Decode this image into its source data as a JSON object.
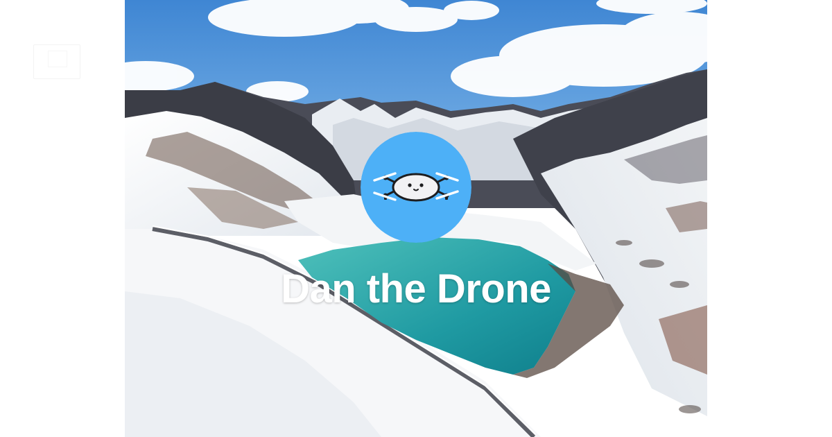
{
  "brand": {
    "name": "Dan the Drone",
    "logo_icon": "drone-mascot-icon",
    "logo_color": "#4db0f7"
  },
  "hero": {
    "scene": "mountain-lake-photo"
  },
  "colors": {
    "sky": "#4b8fd6",
    "lake": "#2fa7a9",
    "snow": "#f4f6f8",
    "rock": "#3d3f48"
  }
}
